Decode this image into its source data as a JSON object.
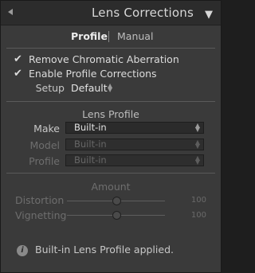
{
  "header": {
    "title": "Lens Corrections"
  },
  "tabs": {
    "active": "Profile",
    "inactive": "Manual"
  },
  "checks": {
    "remove_ca": {
      "label": "Remove Chromatic Aberration",
      "checked": true
    },
    "enable_profile": {
      "label": "Enable Profile Corrections",
      "checked": true
    }
  },
  "setup": {
    "label": "Setup",
    "value": "Default"
  },
  "lens_profile": {
    "title": "Lens Profile",
    "make": {
      "label": "Make",
      "value": "Built-in"
    },
    "model": {
      "label": "Model",
      "value": "Built-in"
    },
    "profile": {
      "label": "Profile",
      "value": "Built-in"
    }
  },
  "amount": {
    "title": "Amount",
    "distortion": {
      "label": "Distortion",
      "value": "100"
    },
    "vignetting": {
      "label": "Vignetting",
      "value": "100"
    }
  },
  "info": {
    "text": "Built-in Lens Profile applied."
  }
}
